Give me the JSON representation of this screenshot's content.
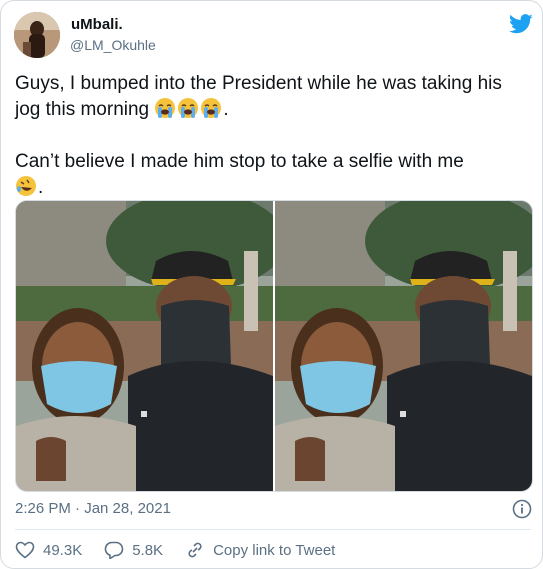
{
  "author": {
    "name": "uMbali.",
    "handle": "@LM_Okuhle",
    "avatar_icon": "avatar-photo"
  },
  "tweet": {
    "line1": "Guys, I bumped into the President while he was taking his jog this morning",
    "line1_end": ".",
    "line1_emoji": [
      "loudly-crying-face",
      "loudly-crying-face",
      "loudly-crying-face"
    ],
    "line2": "Can’t believe I made him stop to take a selfie with me",
    "line2_emoji": [
      "rolling-on-the-floor-laughing"
    ],
    "line2_end": "."
  },
  "photos": [
    {
      "alt": "selfie-photo-1"
    },
    {
      "alt": "selfie-photo-2"
    }
  ],
  "meta": {
    "timestamp": "2:26 PM · Jan 28, 2021",
    "info_icon": "info-icon"
  },
  "actions": {
    "likes": "49.3K",
    "replies": "5.8K",
    "copy_link": "Copy link to Tweet"
  },
  "colors": {
    "twitter_blue": "#1da1f2",
    "secondary_text": "#5b7083"
  }
}
